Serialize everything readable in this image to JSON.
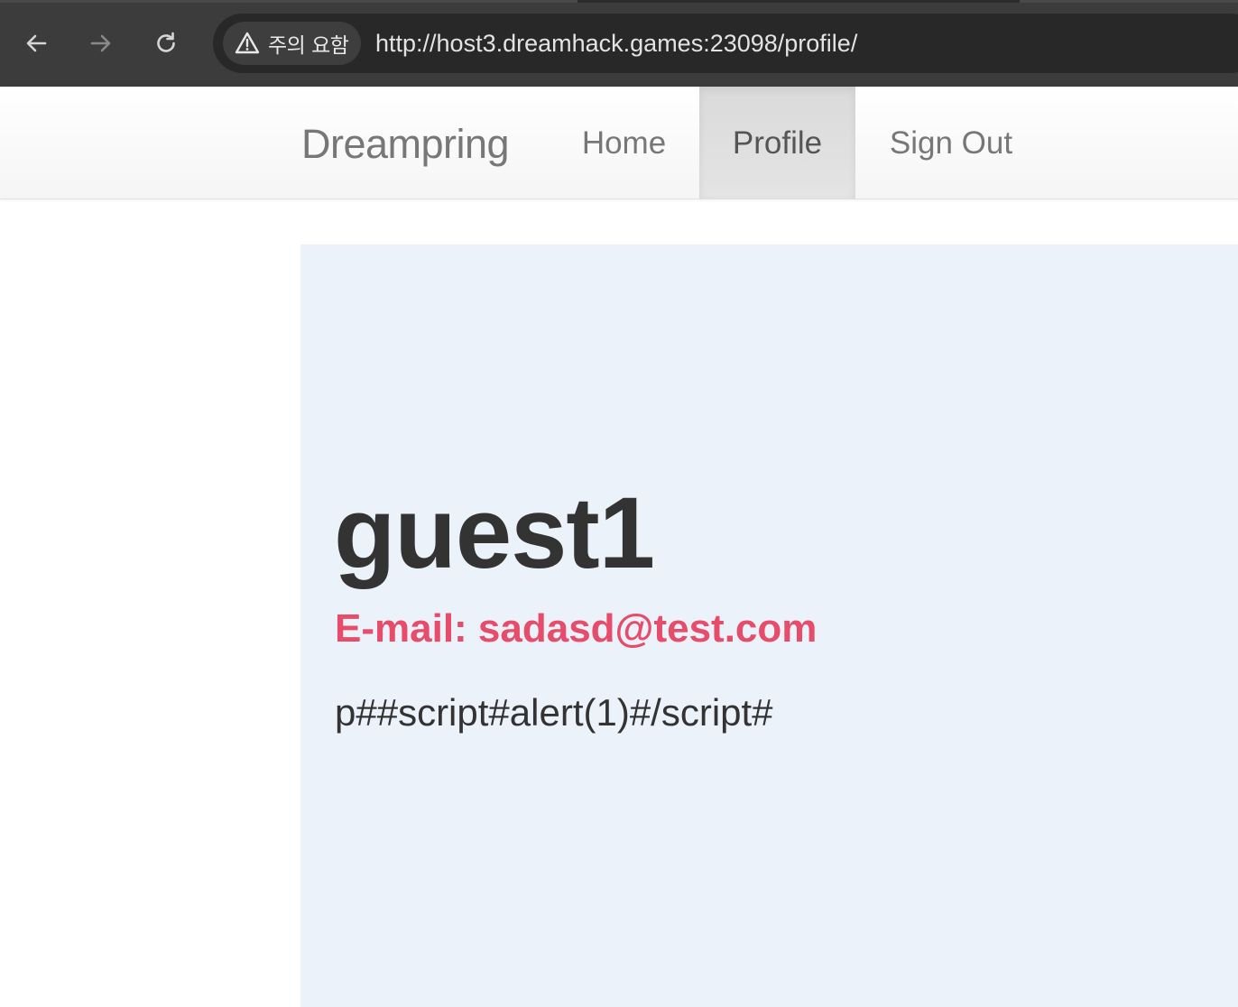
{
  "browser": {
    "security_label": "주의 요함",
    "url": "http://host3.dreamhack.games:23098/profile/",
    "icons": {
      "back": "arrow-left-icon",
      "forward": "arrow-right-icon",
      "reload": "reload-icon",
      "security": "warning-triangle-icon"
    }
  },
  "navbar": {
    "brand": "Dreampring",
    "items": [
      {
        "label": "Home",
        "active": false
      },
      {
        "label": "Profile",
        "active": true
      },
      {
        "label": "Sign Out",
        "active": false
      }
    ]
  },
  "profile": {
    "username": "guest1",
    "email_line": "E-mail: sadasd@test.com",
    "description": "p##script#alert(1)#/script#"
  },
  "colors": {
    "chrome_bg": "#3c3c3c",
    "omnibox_bg": "#282828",
    "jumbotron_bg": "#ecf2f9",
    "email_accent": "#e74c6a",
    "heading_text": "#333333",
    "nav_text": "#777777"
  }
}
